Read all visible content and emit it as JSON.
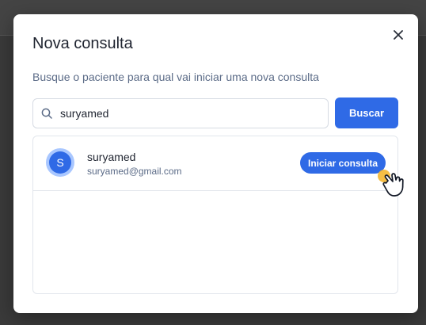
{
  "modal": {
    "title": "Nova consulta",
    "subtitle": "Busque o paciente para qual vai iniciar uma nova consulta",
    "close_icon": "close-icon"
  },
  "search": {
    "value": "suryamed",
    "icon": "search-icon",
    "button_label": "Buscar"
  },
  "results": [
    {
      "avatar_initial": "S",
      "name": "suryamed",
      "email": "suryamed@gmail.com",
      "action_label": "Iniciar consulta"
    }
  ],
  "colors": {
    "accent": "#2f6ae6",
    "avatar_ring": "#a9c7ff",
    "click_highlight": "#f5b731"
  },
  "cursor_icon": "hand-pointer-icon"
}
